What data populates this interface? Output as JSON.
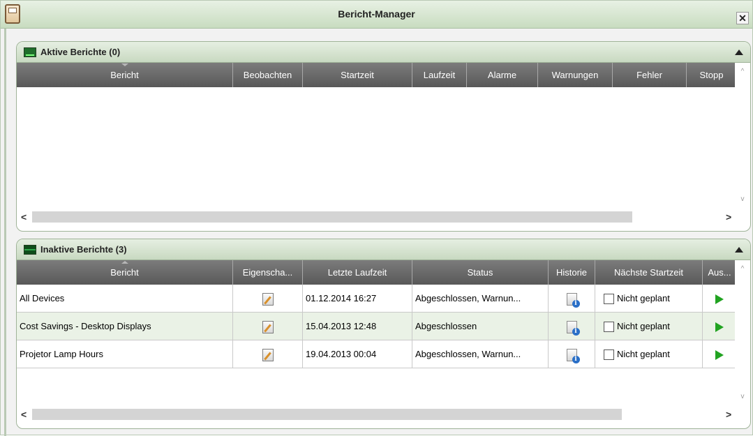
{
  "window": {
    "title": "Bericht-Manager",
    "close_label": "✕"
  },
  "active_group": {
    "title": "Aktive Berichte (0)",
    "columns": [
      "Bericht",
      "Beobachten",
      "Startzeit",
      "Laufzeit",
      "Alarme",
      "Warnungen",
      "Fehler",
      "Stopp"
    ]
  },
  "inactive_group": {
    "title": "Inaktive Berichte (3)",
    "columns": [
      "Bericht",
      "Eigenscha...",
      "Letzte Laufzeit",
      "Status",
      "Historie",
      "Nächste Startzeit",
      "Aus..."
    ],
    "rows": [
      {
        "name": "All Devices",
        "last_run": "01.12.2014 16:27",
        "status": "Abgeschlossen, Warnun...",
        "next_start": "Nicht geplant"
      },
      {
        "name": "Cost Savings - Desktop Displays",
        "last_run": "15.04.2013 12:48",
        "status": "Abgeschlossen",
        "next_start": "Nicht geplant"
      },
      {
        "name": "Projetor Lamp Hours",
        "last_run": "19.04.2013 00:04",
        "status": "Abgeschlossen, Warnun...",
        "next_start": "Nicht geplant"
      }
    ]
  },
  "scroll": {
    "left_arrow": "<",
    "right_arrow": ">",
    "up_arrow": "^",
    "down_arrow": "v"
  }
}
